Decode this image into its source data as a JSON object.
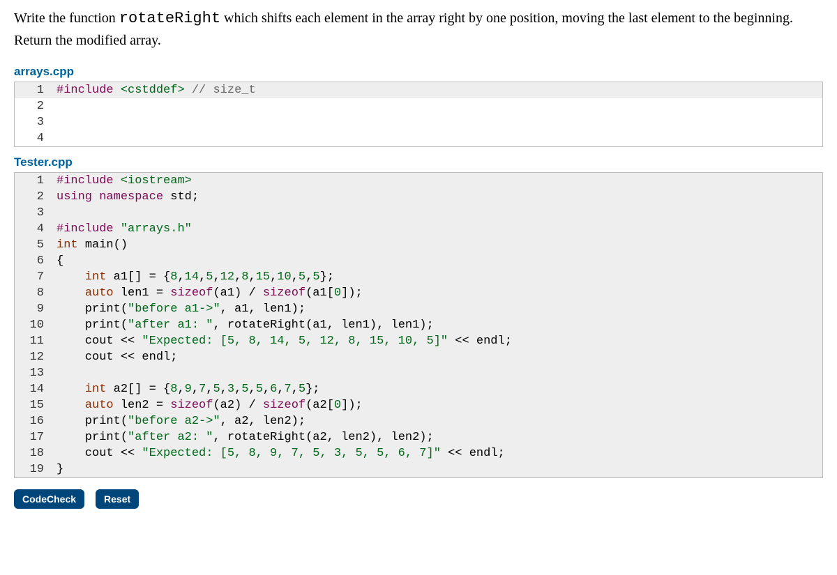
{
  "problem": {
    "prefix": "Write the function ",
    "function_name": "rotateRight",
    "suffix": " which shifts each element in the array right by one position, moving the last element to the beginning. Return the modified array."
  },
  "file1": {
    "name": "arrays.cpp",
    "lines": [
      {
        "n": "1",
        "hl": true,
        "tokens": [
          {
            "t": "#include ",
            "c": "tok-macro"
          },
          {
            "t": "<cstddef>",
            "c": "tok-hdr"
          },
          {
            "t": " // size_t",
            "c": "tok-cmnt"
          }
        ]
      },
      {
        "n": "2",
        "hl": false,
        "tokens": [
          {
            "t": "",
            "c": ""
          }
        ]
      },
      {
        "n": "3",
        "hl": false,
        "tokens": [
          {
            "t": "",
            "c": ""
          }
        ]
      },
      {
        "n": "4",
        "hl": false,
        "tokens": [
          {
            "t": "",
            "c": ""
          }
        ]
      }
    ]
  },
  "file2": {
    "name": "Tester.cpp",
    "lines": [
      {
        "n": "1",
        "tokens": [
          {
            "t": "#include ",
            "c": "tok-macro"
          },
          {
            "t": "<iostream>",
            "c": "tok-hdr"
          }
        ]
      },
      {
        "n": "2",
        "tokens": [
          {
            "t": "using ",
            "c": "tok-kw"
          },
          {
            "t": "namespace ",
            "c": "tok-kw"
          },
          {
            "t": "std;",
            "c": ""
          }
        ]
      },
      {
        "n": "3",
        "tokens": [
          {
            "t": "",
            "c": ""
          }
        ]
      },
      {
        "n": "4",
        "tokens": [
          {
            "t": "#include ",
            "c": "tok-macro"
          },
          {
            "t": "\"arrays.h\"",
            "c": "tok-hdr"
          }
        ]
      },
      {
        "n": "5",
        "tokens": [
          {
            "t": "int ",
            "c": "tok-type"
          },
          {
            "t": "main()",
            "c": ""
          }
        ]
      },
      {
        "n": "6",
        "tokens": [
          {
            "t": "{",
            "c": ""
          }
        ]
      },
      {
        "n": "7",
        "tokens": [
          {
            "t": "    ",
            "c": ""
          },
          {
            "t": "int ",
            "c": "tok-type"
          },
          {
            "t": "a1[] = {",
            "c": ""
          },
          {
            "t": "8",
            "c": "tok-num"
          },
          {
            "t": ",",
            "c": ""
          },
          {
            "t": "14",
            "c": "tok-num"
          },
          {
            "t": ",",
            "c": ""
          },
          {
            "t": "5",
            "c": "tok-num"
          },
          {
            "t": ",",
            "c": ""
          },
          {
            "t": "12",
            "c": "tok-num"
          },
          {
            "t": ",",
            "c": ""
          },
          {
            "t": "8",
            "c": "tok-num"
          },
          {
            "t": ",",
            "c": ""
          },
          {
            "t": "15",
            "c": "tok-num"
          },
          {
            "t": ",",
            "c": ""
          },
          {
            "t": "10",
            "c": "tok-num"
          },
          {
            "t": ",",
            "c": ""
          },
          {
            "t": "5",
            "c": "tok-num"
          },
          {
            "t": ",",
            "c": ""
          },
          {
            "t": "5",
            "c": "tok-num"
          },
          {
            "t": "};",
            "c": ""
          }
        ]
      },
      {
        "n": "8",
        "tokens": [
          {
            "t": "    ",
            "c": ""
          },
          {
            "t": "auto ",
            "c": "tok-type"
          },
          {
            "t": "len1 = ",
            "c": ""
          },
          {
            "t": "sizeof",
            "c": "tok-kw"
          },
          {
            "t": "(a1) / ",
            "c": ""
          },
          {
            "t": "sizeof",
            "c": "tok-kw"
          },
          {
            "t": "(a1[",
            "c": ""
          },
          {
            "t": "0",
            "c": "tok-num"
          },
          {
            "t": "]);",
            "c": ""
          }
        ]
      },
      {
        "n": "9",
        "tokens": [
          {
            "t": "    print(",
            "c": ""
          },
          {
            "t": "\"before a1->\"",
            "c": "tok-str"
          },
          {
            "t": ", a1, len1);",
            "c": ""
          }
        ]
      },
      {
        "n": "10",
        "tokens": [
          {
            "t": "    print(",
            "c": ""
          },
          {
            "t": "\"after a1: \"",
            "c": "tok-str"
          },
          {
            "t": ", rotateRight(a1, len1), len1);",
            "c": ""
          }
        ]
      },
      {
        "n": "11",
        "tokens": [
          {
            "t": "    cout << ",
            "c": ""
          },
          {
            "t": "\"Expected: [5, 8, 14, 5, 12, 8, 15, 10, 5]\"",
            "c": "tok-str"
          },
          {
            "t": " << endl;",
            "c": ""
          }
        ]
      },
      {
        "n": "12",
        "tokens": [
          {
            "t": "    cout << endl;",
            "c": ""
          }
        ]
      },
      {
        "n": "13",
        "tokens": [
          {
            "t": "",
            "c": ""
          }
        ]
      },
      {
        "n": "14",
        "tokens": [
          {
            "t": "    ",
            "c": ""
          },
          {
            "t": "int ",
            "c": "tok-type"
          },
          {
            "t": "a2[] = {",
            "c": ""
          },
          {
            "t": "8",
            "c": "tok-num"
          },
          {
            "t": ",",
            "c": ""
          },
          {
            "t": "9",
            "c": "tok-num"
          },
          {
            "t": ",",
            "c": ""
          },
          {
            "t": "7",
            "c": "tok-num"
          },
          {
            "t": ",",
            "c": ""
          },
          {
            "t": "5",
            "c": "tok-num"
          },
          {
            "t": ",",
            "c": ""
          },
          {
            "t": "3",
            "c": "tok-num"
          },
          {
            "t": ",",
            "c": ""
          },
          {
            "t": "5",
            "c": "tok-num"
          },
          {
            "t": ",",
            "c": ""
          },
          {
            "t": "5",
            "c": "tok-num"
          },
          {
            "t": ",",
            "c": ""
          },
          {
            "t": "6",
            "c": "tok-num"
          },
          {
            "t": ",",
            "c": ""
          },
          {
            "t": "7",
            "c": "tok-num"
          },
          {
            "t": ",",
            "c": ""
          },
          {
            "t": "5",
            "c": "tok-num"
          },
          {
            "t": "};",
            "c": ""
          }
        ]
      },
      {
        "n": "15",
        "tokens": [
          {
            "t": "    ",
            "c": ""
          },
          {
            "t": "auto ",
            "c": "tok-type"
          },
          {
            "t": "len2 = ",
            "c": ""
          },
          {
            "t": "sizeof",
            "c": "tok-kw"
          },
          {
            "t": "(a2) / ",
            "c": ""
          },
          {
            "t": "sizeof",
            "c": "tok-kw"
          },
          {
            "t": "(a2[",
            "c": ""
          },
          {
            "t": "0",
            "c": "tok-num"
          },
          {
            "t": "]);",
            "c": ""
          }
        ]
      },
      {
        "n": "16",
        "tokens": [
          {
            "t": "    print(",
            "c": ""
          },
          {
            "t": "\"before a2->\"",
            "c": "tok-str"
          },
          {
            "t": ", a2, len2);",
            "c": ""
          }
        ]
      },
      {
        "n": "17",
        "tokens": [
          {
            "t": "    print(",
            "c": ""
          },
          {
            "t": "\"after a2: \"",
            "c": "tok-str"
          },
          {
            "t": ", rotateRight(a2, len2), len2);",
            "c": ""
          }
        ]
      },
      {
        "n": "18",
        "tokens": [
          {
            "t": "    cout << ",
            "c": ""
          },
          {
            "t": "\"Expected: [5, 8, 9, 7, 5, 3, 5, 5, 6, 7]\"",
            "c": "tok-str"
          },
          {
            "t": " << endl;",
            "c": ""
          }
        ]
      },
      {
        "n": "19",
        "tokens": [
          {
            "t": "}",
            "c": ""
          }
        ]
      }
    ]
  },
  "buttons": {
    "codecheck": "CodeCheck",
    "reset": "Reset"
  }
}
